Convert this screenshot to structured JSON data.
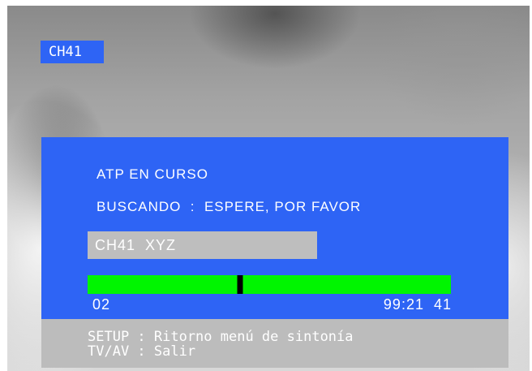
{
  "osd": {
    "channel_badge": "CH41",
    "status_title": "ATP EN CURSO",
    "search_status": "BUSCANDO  :  ESPERE, POR FAVOR",
    "current_channel": "CH41  XYZ",
    "progress": {
      "start_label": "02",
      "end_label": "99:21  41",
      "fraction": 0.42
    },
    "help": {
      "setup_hint": "SETUP : Ritorno menú de sintonía",
      "tvav_hint": "TV/AV : Salir"
    }
  },
  "colors": {
    "osd_blue": "#2e64f5",
    "progress_green": "#00f500",
    "marker_black": "#000000",
    "gray_box": "#bebebe"
  }
}
